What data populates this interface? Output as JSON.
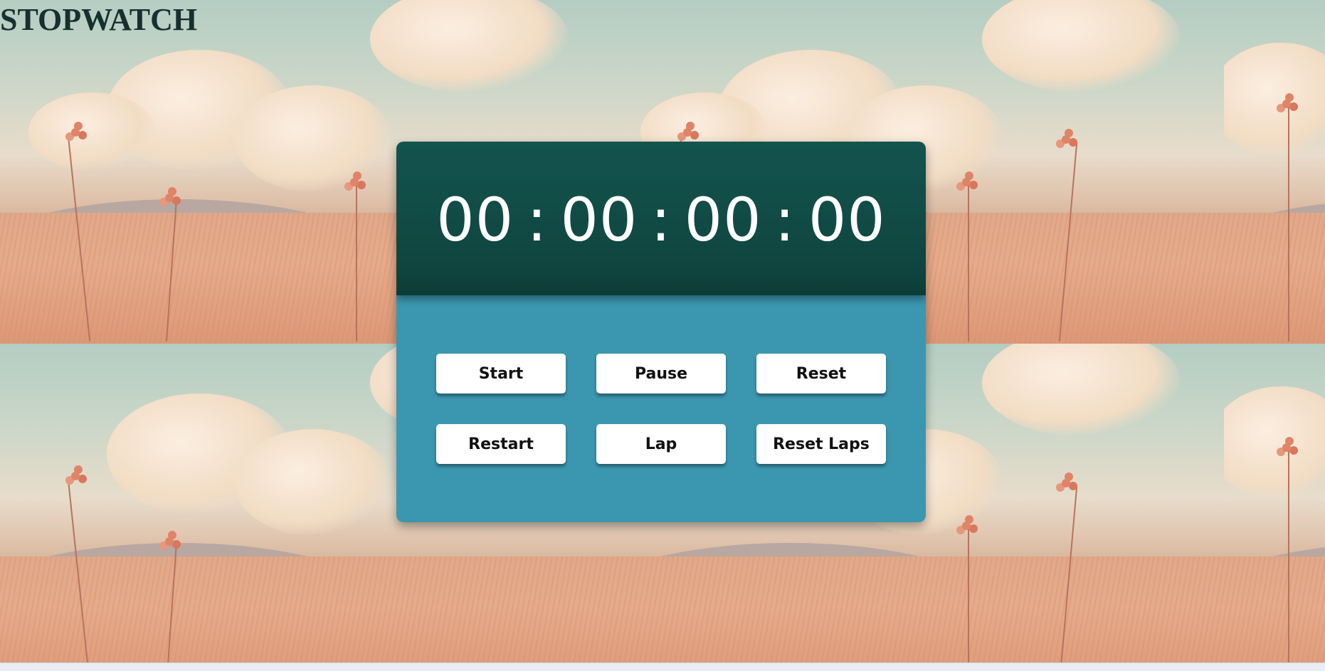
{
  "app": {
    "title": "STOPWATCH"
  },
  "display": {
    "hours": "00",
    "minutes": "00",
    "seconds": "00",
    "centiseconds": "00",
    "separator": ":"
  },
  "controls": {
    "start_label": "Start",
    "pause_label": "Pause",
    "reset_label": "Reset",
    "restart_label": "Restart",
    "lap_label": "Lap",
    "reset_laps_label": "Reset Laps"
  },
  "theme": {
    "display_bg": "#13544f",
    "controls_bg": "#3b97b0",
    "button_bg": "#ffffff",
    "title_color": "#16302f"
  }
}
